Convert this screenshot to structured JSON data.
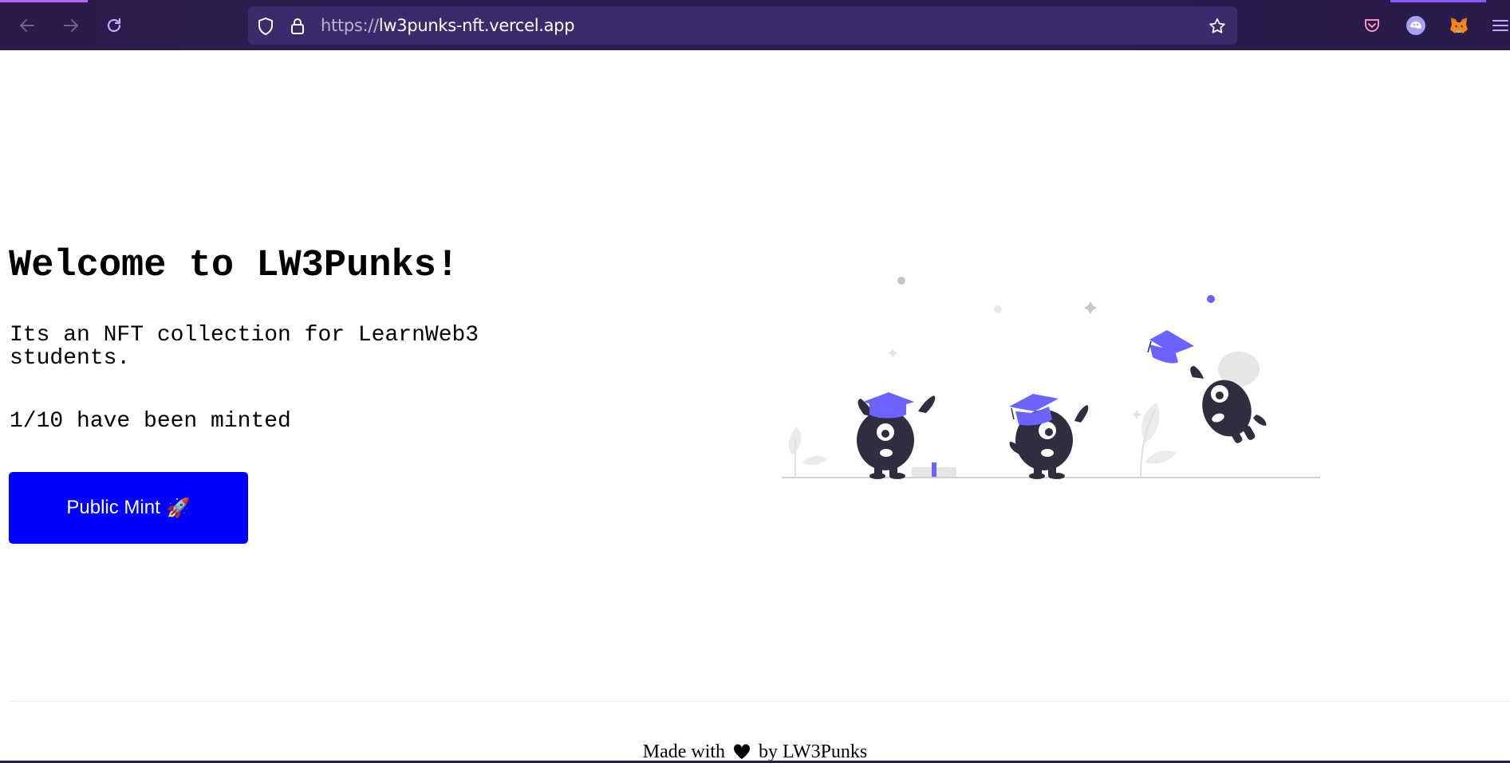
{
  "browser": {
    "url_protocol": "https://",
    "url_host": "lw3punks-nft.vercel.app",
    "icons": [
      "back-arrow-icon",
      "forward-arrow-icon",
      "reload-icon",
      "shield-icon",
      "lock-icon",
      "star-icon",
      "pocket-icon",
      "ghost-extension-icon",
      "metamask-fox-icon",
      "hamburger-menu-icon"
    ]
  },
  "hero": {
    "title": "Welcome to LW3Punks!",
    "description": "Its an NFT collection for LearnWeb3 students.",
    "minted_status": "1/10 have been minted",
    "minted": 1,
    "total": 10,
    "mint_button_label": "Public Mint",
    "mint_button_emoji": "🚀"
  },
  "footer": {
    "prefix": "Made with",
    "suffix": "by LW3Punks",
    "heart_icon": "heart-icon"
  },
  "colors": {
    "toolbar": "#2b1d52",
    "urlbar": "#3b2b6b",
    "mint_button": "#0000ff",
    "illustration_accent": "#6c63ff",
    "illustration_dark": "#2f2e41"
  }
}
